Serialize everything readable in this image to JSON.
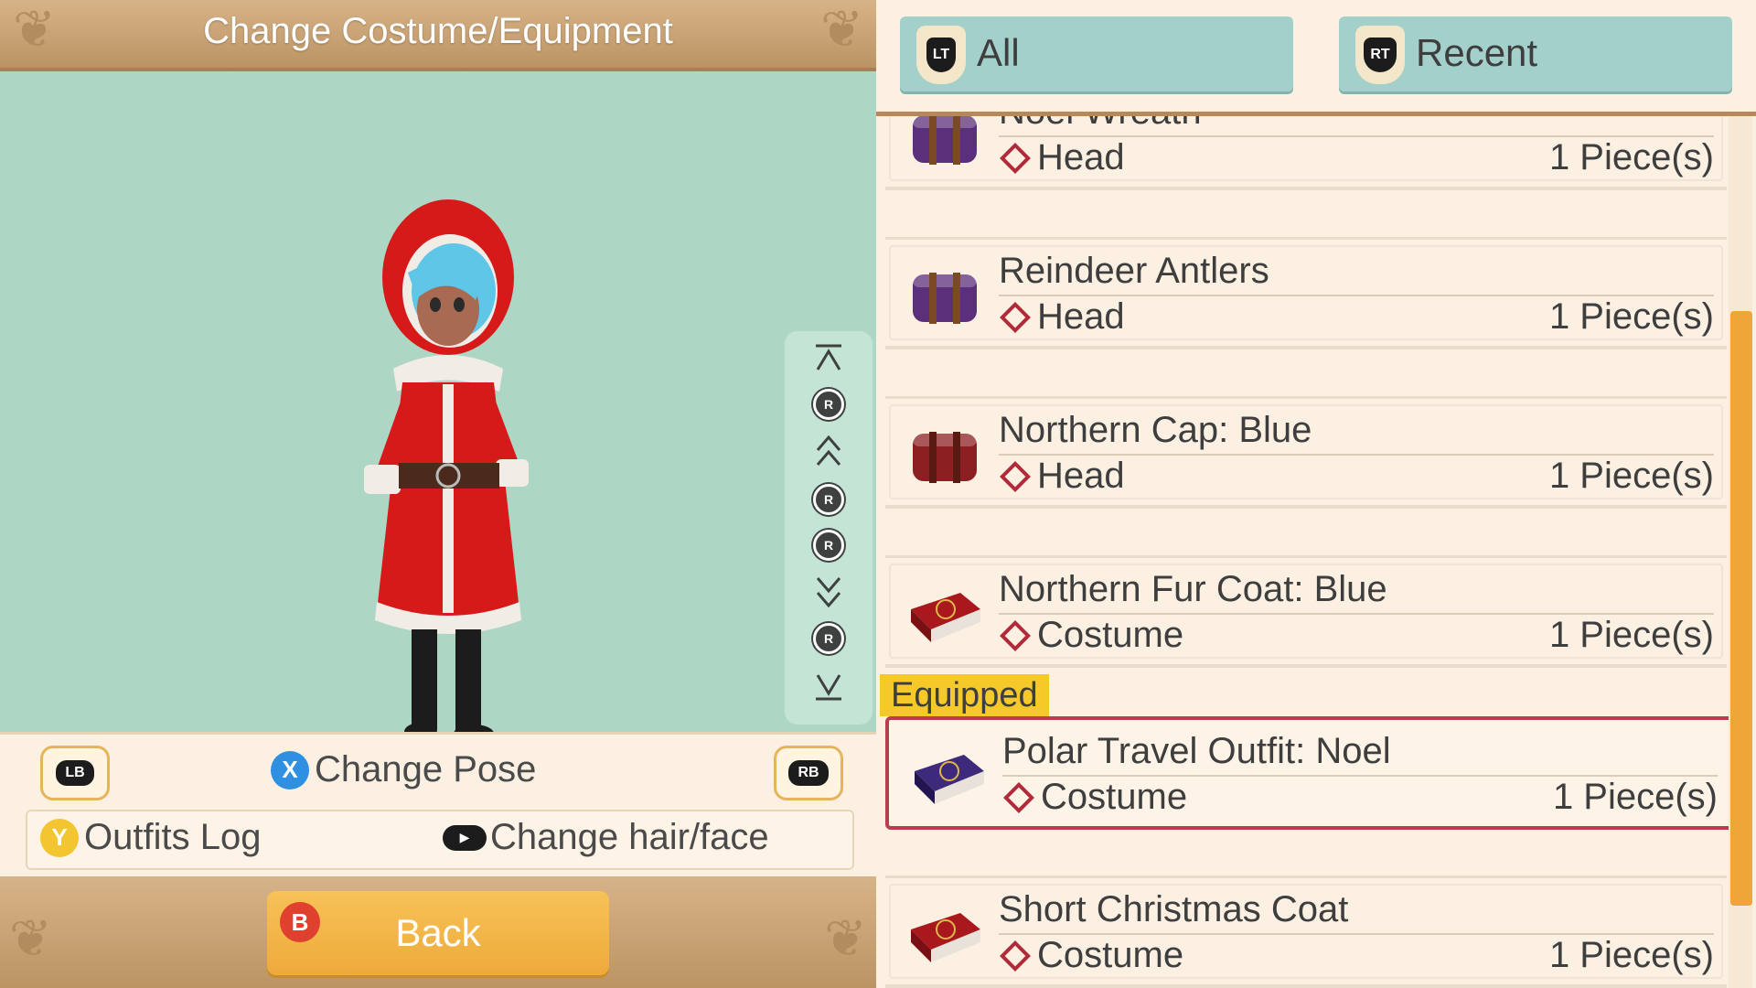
{
  "header": {
    "title": "Change Costume/Equipment"
  },
  "controls": {
    "lb": "LB",
    "rb": "RB",
    "change_pose_button": "X",
    "change_pose": "Change Pose",
    "outfits_log_button": "Y",
    "outfits_log": "Outfits Log",
    "change_hair_face": "Change hair/face",
    "back_button": "B",
    "back": "Back"
  },
  "camera": {
    "stick_label": "R"
  },
  "tabs": [
    {
      "trigger": "LT",
      "label": "All"
    },
    {
      "trigger": "RT",
      "label": "Recent"
    }
  ],
  "items": [
    {
      "name": "Noel Wreath",
      "slot": "Head",
      "qty": "1 Piece(s)",
      "box_color": "#5b2f7a"
    },
    {
      "name": "Reindeer Antlers",
      "slot": "Head",
      "qty": "1 Piece(s)",
      "box_color": "#5b2f7a"
    },
    {
      "name": "Northern Cap: Blue",
      "slot": "Head",
      "qty": "1 Piece(s)",
      "box_color": "#8c1f22"
    },
    {
      "name": "Northern Fur Coat: Blue",
      "slot": "Costume",
      "qty": "1 Piece(s)",
      "box_color": "#a8181c"
    },
    {
      "name": "Polar Travel Outfit: Noel",
      "slot": "Costume",
      "qty": "1 Piece(s)",
      "box_color": "#3d2a7a"
    },
    {
      "name": "Short Christmas Coat",
      "slot": "Costume",
      "qty": "1 Piece(s)",
      "box_color": "#a8181c"
    }
  ],
  "equipped_label": "Equipped",
  "colors": {
    "accent": "#f0a538",
    "equipped_border": "#b83d4f",
    "viewport_bg": "#aed6c4"
  }
}
